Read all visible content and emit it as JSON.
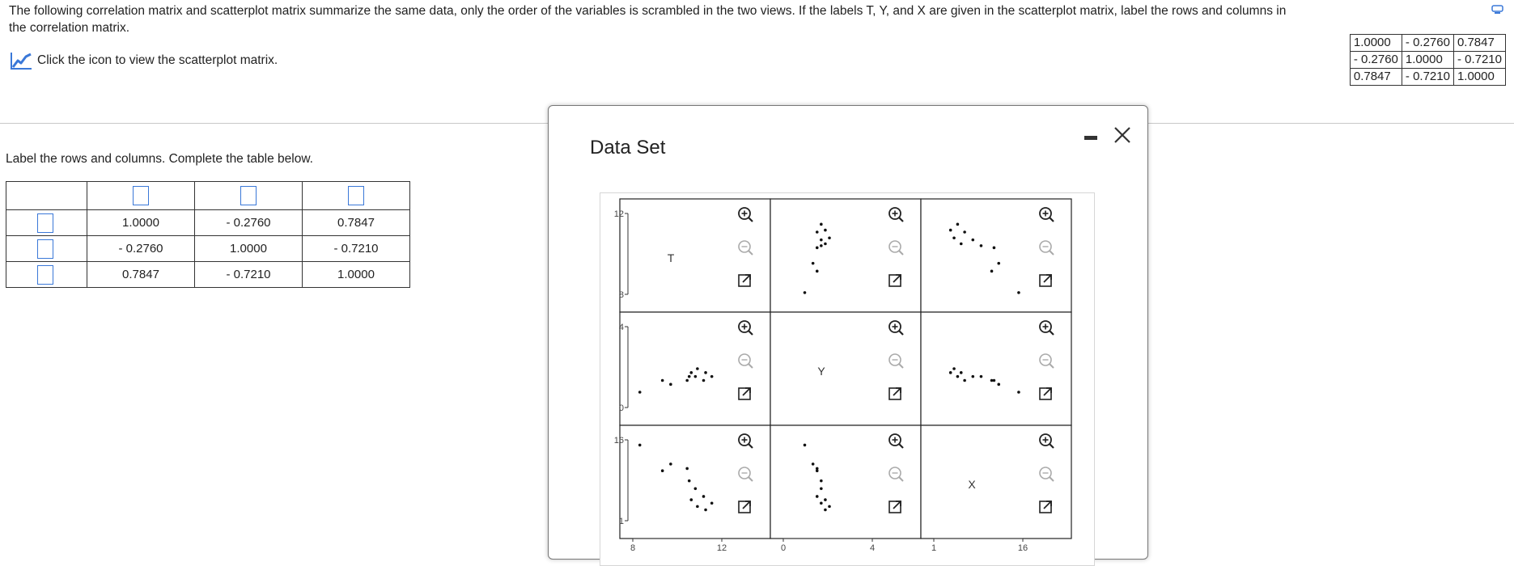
{
  "question": {
    "text": "The following correlation matrix and scatterplot matrix summarize the same data, only the order of the variables is scrambled in the two views. If the labels T, Y, and X are given in the scatterplot matrix, label the rows and columns in the correlation matrix.",
    "link_text": "Click the icon to view the scatterplot matrix."
  },
  "top_matrix": {
    "rows": [
      [
        "1.0000",
        "- 0.2760",
        "0.7847"
      ],
      [
        "- 0.2760",
        "1.0000",
        "- 0.7210"
      ],
      [
        "0.7847",
        "- 0.7210",
        "1.0000"
      ]
    ]
  },
  "instructions": "Label the rows and columns. Complete the table below.",
  "answer_table": {
    "rows": [
      [
        "1.0000",
        "- 0.2760",
        "0.7847"
      ],
      [
        "- 0.2760",
        "1.0000",
        "- 0.7210"
      ],
      [
        "0.7847",
        "- 0.7210",
        "1.0000"
      ]
    ]
  },
  "dialog": {
    "title": "Data Set",
    "colors": {
      "accent": "#3a78d8",
      "zoom_in": "#222222",
      "zoom_out_disabled": "#aaaaaa"
    },
    "icons": [
      "zoom-in-icon",
      "zoom-out-icon",
      "popout-icon",
      "minimize-icon",
      "close-icon",
      "graph-icon"
    ]
  },
  "chart_data": {
    "type": "scatter",
    "variables": [
      "T",
      "Y",
      "X"
    ],
    "observations": {
      "T": [
        8.1,
        9.2,
        9.6,
        10.4,
        10.5,
        10.6,
        10.8,
        10.9,
        11.2,
        11.3,
        11.6
      ],
      "Y": [
        0.8,
        1.4,
        1.2,
        1.4,
        1.6,
        1.8,
        1.6,
        2.0,
        1.4,
        1.8,
        1.6
      ],
      "X": [
        15.2,
        10.6,
        11.8,
        11.0,
        8.8,
        5.4,
        7.4,
        4.2,
        6.0,
        3.6,
        4.8
      ]
    },
    "axes": {
      "T": {
        "range": [
          7.6,
          12.4
        ],
        "ticks": [
          "8",
          "12"
        ],
        "ticks_left": [
          "8",
          "12"
        ]
      },
      "Y": {
        "range": [
          -0.4,
          4.4
        ],
        "ticks": [
          "0",
          "4"
        ],
        "ticks_left": [
          "0",
          "4"
        ]
      },
      "X": {
        "range": [
          0.2,
          17.0
        ],
        "ticks": [
          "1",
          "16"
        ],
        "ticks_left": [
          "1",
          "16"
        ]
      }
    }
  }
}
